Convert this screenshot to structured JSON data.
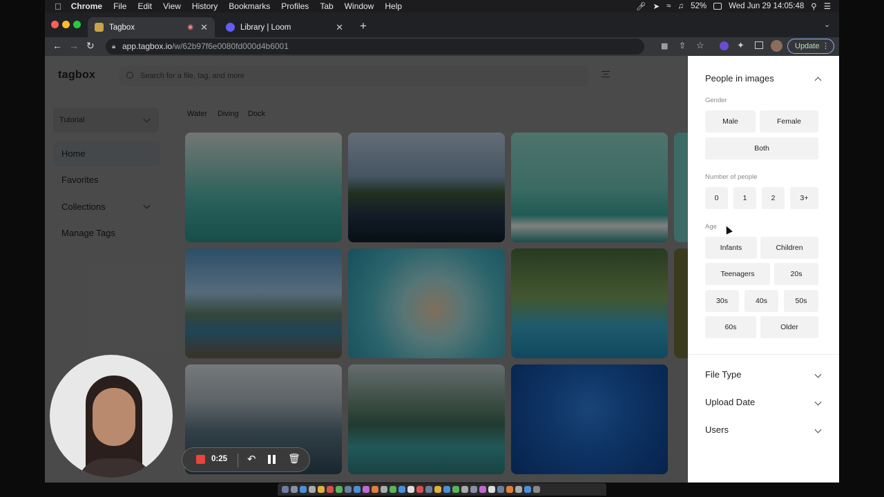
{
  "menubar": {
    "apple": "",
    "app": "Chrome",
    "items": [
      "File",
      "Edit",
      "View",
      "History",
      "Bookmarks",
      "Profiles",
      "Tab",
      "Window",
      "Help"
    ],
    "battery": "52%",
    "datetime": "Wed Jun 29  14:05:48"
  },
  "browser": {
    "tabs": [
      {
        "title": "Tagbox",
        "favicon_color": "#c9a24a",
        "active": true
      },
      {
        "title": "Library | Loom",
        "favicon_color": "#625df5",
        "active": false
      }
    ],
    "new_tab": "+",
    "url_host": "app.tagbox.io",
    "url_path": "/w/62b97f6e0080fd000d4b6001",
    "update_label": "Update"
  },
  "app": {
    "logo": "tagbox",
    "search_placeholder": "Search for a file, tag, and more",
    "workspace": "Tutorial",
    "nav": [
      "Home",
      "Favorites",
      "Collections",
      "Manage Tags"
    ],
    "tag_chips": [
      "Water",
      "Diving",
      "Dock"
    ]
  },
  "recording": {
    "time": "0:25"
  },
  "filter_panel": {
    "title": "People in images",
    "gender_label": "Gender",
    "gender": [
      "Male",
      "Female",
      "Both"
    ],
    "count_label": "Number of people",
    "counts": [
      "0",
      "1",
      "2",
      "3+"
    ],
    "age_label": "Age",
    "ages": [
      "Infants",
      "Children",
      "Teenagers",
      "20s",
      "30s",
      "40s",
      "50s",
      "60s",
      "Older"
    ],
    "sections": [
      "File Type",
      "Upload Date",
      "Users"
    ]
  },
  "colors": {
    "accent_update": "#8ab4f8",
    "recording_red": "#e8453c"
  }
}
